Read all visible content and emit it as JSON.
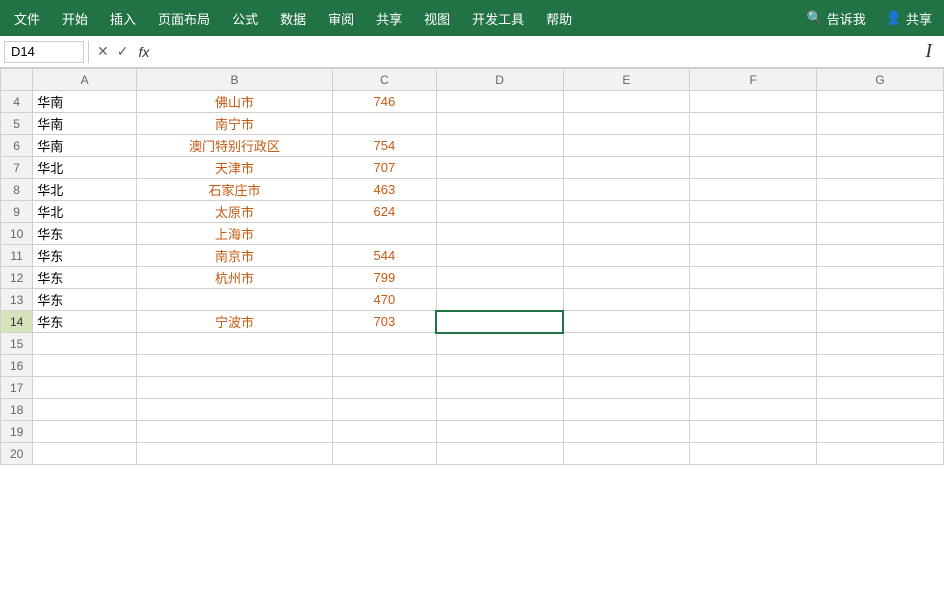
{
  "menubar": {
    "items": [
      "文件",
      "开始",
      "插入",
      "页面布局",
      "公式",
      "数据",
      "审阅",
      "共享",
      "视图",
      "开发工具",
      "帮助"
    ],
    "search_label": "告诉我",
    "share_label": "共享",
    "bg_color": "#217346"
  },
  "formulabar": {
    "cell_ref": "D14",
    "formula_text": "",
    "fx_label": "fx",
    "cancel_symbol": "×",
    "confirm_symbol": "✓"
  },
  "columns": {
    "headers": [
      "A",
      "B",
      "C",
      "D",
      "E",
      "F",
      "G"
    ],
    "row_numbers": [
      4,
      5,
      6,
      7,
      8,
      9,
      10,
      11,
      12,
      13,
      14,
      15,
      16,
      17,
      18,
      19,
      20
    ]
  },
  "rows": [
    {
      "row": 4,
      "col_a": "华南",
      "col_b": "佛山市",
      "col_c": "746"
    },
    {
      "row": 5,
      "col_a": "华南",
      "col_b": "南宁市",
      "col_c": ""
    },
    {
      "row": 6,
      "col_a": "华南",
      "col_b": "澳门特别行政区",
      "col_c": "754"
    },
    {
      "row": 7,
      "col_a": "华北",
      "col_b": "天津市",
      "col_c": "707"
    },
    {
      "row": 8,
      "col_a": "华北",
      "col_b": "石家庄市",
      "col_c": "463"
    },
    {
      "row": 9,
      "col_a": "华北",
      "col_b": "太原市",
      "col_c": "624"
    },
    {
      "row": 10,
      "col_a": "华东",
      "col_b": "上海市",
      "col_c": ""
    },
    {
      "row": 11,
      "col_a": "华东",
      "col_b": "南京市",
      "col_c": "544"
    },
    {
      "row": 12,
      "col_a": "华东",
      "col_b": "杭州市",
      "col_c": "799"
    },
    {
      "row": 13,
      "col_a": "华东",
      "col_b": "",
      "col_c": "470"
    },
    {
      "row": 14,
      "col_a": "华东",
      "col_b": "宁波市",
      "col_c": "703"
    },
    {
      "row": 15,
      "col_a": "",
      "col_b": "",
      "col_c": ""
    },
    {
      "row": 16,
      "col_a": "",
      "col_b": "",
      "col_c": ""
    },
    {
      "row": 17,
      "col_a": "",
      "col_b": "",
      "col_c": ""
    },
    {
      "row": 18,
      "col_a": "",
      "col_b": "",
      "col_c": ""
    },
    {
      "row": 19,
      "col_a": "",
      "col_b": "",
      "col_c": ""
    },
    {
      "row": 20,
      "col_a": "",
      "col_b": "",
      "col_c": ""
    }
  ]
}
